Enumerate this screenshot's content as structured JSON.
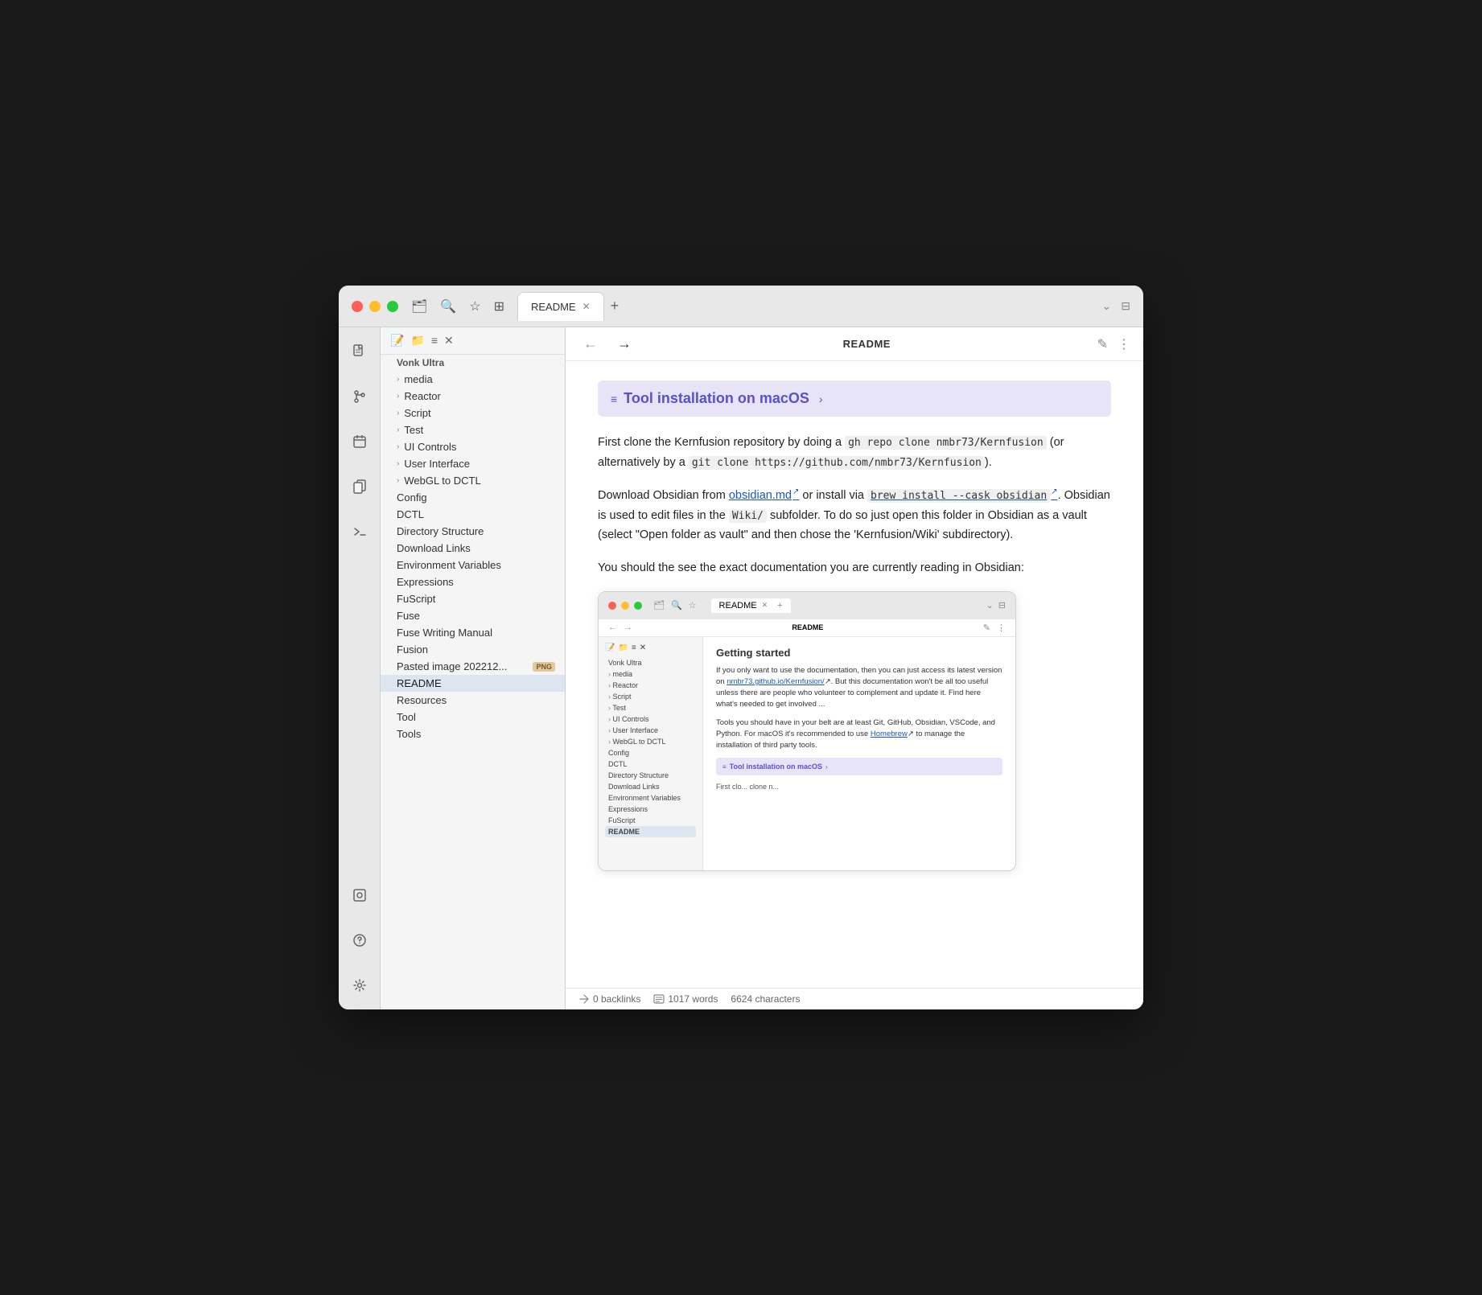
{
  "window": {
    "tab_label": "README",
    "header_title": "README"
  },
  "sidebar_icons": {
    "file_icon": "📄",
    "git_icon": "⎇",
    "calendar_icon": "📅",
    "copy_icon": "⧉",
    "terminal_icon": ">_"
  },
  "file_tree": {
    "root_label": "Vonk Ultra",
    "items": [
      {
        "label": "media",
        "type": "folder",
        "indent": 1
      },
      {
        "label": "Reactor",
        "type": "folder",
        "indent": 1
      },
      {
        "label": "Script",
        "type": "folder",
        "indent": 1
      },
      {
        "label": "Test",
        "type": "folder",
        "indent": 1
      },
      {
        "label": "UI Controls",
        "type": "folder",
        "indent": 1
      },
      {
        "label": "User Interface",
        "type": "folder",
        "indent": 1
      },
      {
        "label": "WebGL to DCTL",
        "type": "folder",
        "indent": 1
      },
      {
        "label": "Config",
        "type": "file",
        "indent": 0
      },
      {
        "label": "DCTL",
        "type": "file",
        "indent": 0
      },
      {
        "label": "Directory Structure",
        "type": "file",
        "indent": 0
      },
      {
        "label": "Download Links",
        "type": "file",
        "indent": 0
      },
      {
        "label": "Environment Variables",
        "type": "file",
        "indent": 0
      },
      {
        "label": "Expressions",
        "type": "file",
        "indent": 0
      },
      {
        "label": "FuScript",
        "type": "file",
        "indent": 0
      },
      {
        "label": "Fuse",
        "type": "file",
        "indent": 0
      },
      {
        "label": "Fuse Writing Manual",
        "type": "file",
        "indent": 0
      },
      {
        "label": "Fusion",
        "type": "file",
        "indent": 0
      },
      {
        "label": "Pasted image 202212...",
        "type": "file_png",
        "indent": 0
      },
      {
        "label": "README",
        "type": "file_active",
        "indent": 0
      },
      {
        "label": "Resources",
        "type": "file",
        "indent": 0
      },
      {
        "label": "Tool",
        "type": "file",
        "indent": 0
      },
      {
        "label": "Tools",
        "type": "file",
        "indent": 0
      }
    ]
  },
  "readme": {
    "section_title": "Tool installation on macOS",
    "paragraph1_start": "First clone the Kernfusion repository by doing a ",
    "code1": "gh repo clone nmbr73/Kernfusion",
    "paragraph1_mid": " (or alternatively by a ",
    "code2": "git clone https://github.com/nmbr73/Kernfusion",
    "paragraph1_end": ").",
    "paragraph2_start": "Download Obsidian from ",
    "link1": "obsidian.md",
    "paragraph2_mid": " or install via ",
    "link2": "brew install --cask obsidian",
    "paragraph2_end": ". Obsidian is used to edit files in the ",
    "code3": "Wiki/",
    "paragraph2_cont": " subfolder. To do so just open this folder in Obsidian as a vault (select \"Open folder as vault\" and then chose the 'Kernfusion/Wiki' subdirectory).",
    "paragraph3": "You should the see the exact documentation you are currently reading in Obsidian:",
    "preview": {
      "title": "README",
      "heading": "Getting started",
      "body1": "If you only want to use the documentation, then you can just access its latest version on ",
      "body1_link": "nmbr73.github.io/Kernfusion/",
      "body1_cont": ". But this documentation won't be all too useful unless there are people who volunteer to complement and update it. Find here what's needed to get involved ...",
      "body2": "Tools you should have in your belt are at least Git, GitHub, Obsidian, VSCode, and Python. For macOS it's recommended to use ",
      "body2_link": "Homebrew",
      "body2_cont": " to manage the installation of third party tools.",
      "section_label": "Tool installation on macOS",
      "bottom_text": "First clo... clone n..."
    }
  },
  "statusbar": {
    "backlinks": "0 backlinks",
    "words": "1017 words",
    "characters": "6624 characters"
  }
}
